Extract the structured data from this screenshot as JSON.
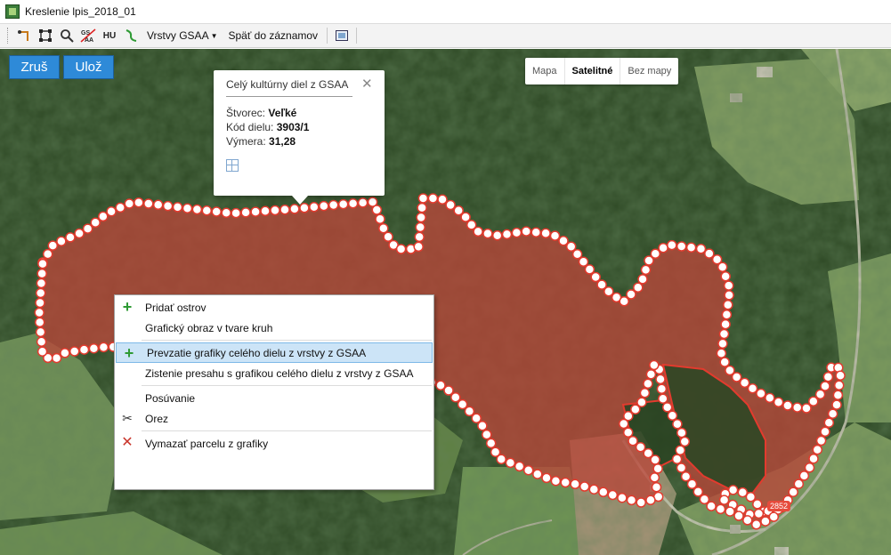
{
  "window": {
    "title": "Kreslenie lpis_2018_01"
  },
  "toolbar": {
    "hu_label": "HU",
    "gsaa_label": "GS\nAA",
    "layers_label": "Vrstvy GSAA",
    "back_label": "Späť do záznamov"
  },
  "actions": {
    "cancel_label": "Zruš",
    "save_label": "Ulož"
  },
  "map_type": {
    "map_label": "Mapa",
    "satellite_label": "Satelitné",
    "nomap_label": "Bez mapy",
    "selected": "Satelitné"
  },
  "popup": {
    "title": "Celý kultúrny diel z GSAA",
    "close": "✕",
    "square_label": "Štvorec: ",
    "square_value": "Veľké",
    "code_label": "Kód dielu: ",
    "code_value": "3903/1",
    "area_label": "Výmera: ",
    "area_value": "31,28"
  },
  "context_menu": {
    "items": [
      {
        "label": "Pridať ostrov",
        "icon": "plus-icon"
      },
      {
        "label": "Grafický obraz v tvare kruh",
        "icon": ""
      },
      {
        "label": "Prevzatie grafiky celého dielu z vrstvy z GSAA",
        "icon": "plus-icon",
        "highlighted": true
      },
      {
        "label": "Zistenie presahu s grafikou celého dielu z vrstvy z GSAA",
        "icon": ""
      },
      {
        "label": "Posúvanie",
        "icon": ""
      },
      {
        "label": "Orez",
        "icon": "scissors-icon"
      },
      {
        "label": "Vymazať parcelu z grafiky",
        "icon": "delete-icon"
      }
    ]
  },
  "map_labels": {
    "road_number": "2852"
  },
  "colors": {
    "parcel_fill": "#b8463a",
    "parcel_stroke": "#e23b2e",
    "button_blue": "#2e8ad8",
    "forest": "#2f4a26",
    "field": "#6f8f55"
  }
}
